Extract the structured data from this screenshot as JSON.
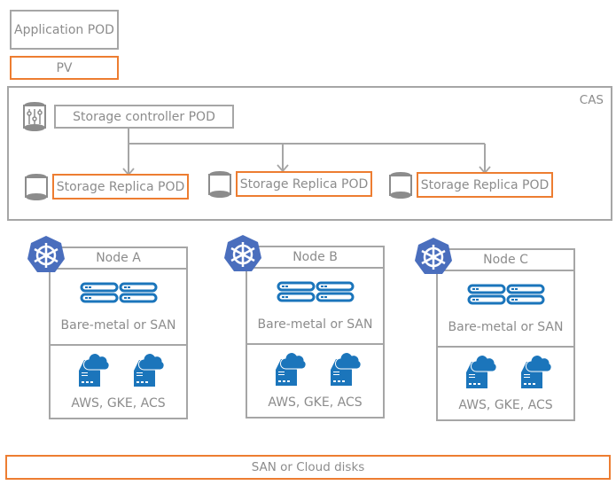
{
  "legend": {
    "application_pod": "Application POD",
    "pv": "PV"
  },
  "cas": {
    "label": "CAS",
    "controller": {
      "label": "Storage controller POD",
      "icon": "storage-controller-cylinder-icon"
    },
    "replicas": [
      {
        "label": "Storage Replica POD",
        "icon": "storage-cylinder-icon"
      },
      {
        "label": "Storage Replica POD",
        "icon": "storage-cylinder-icon"
      },
      {
        "label": "Storage Replica POD",
        "icon": "storage-cylinder-icon"
      }
    ]
  },
  "nodes": [
    {
      "title": "Node A",
      "bare_metal_label": "Bare-metal or SAN",
      "cloud_label": "AWS, GKE, ACS"
    },
    {
      "title": "Node B",
      "bare_metal_label": "Bare-metal or SAN",
      "cloud_label": "AWS, GKE, ACS"
    },
    {
      "title": "Node C",
      "bare_metal_label": "Bare-metal or SAN",
      "cloud_label": "AWS, GKE, ACS"
    }
  ],
  "footer": {
    "label": "SAN or Cloud disks"
  },
  "colors": {
    "gray_border": "#a6a6a6",
    "orange_border": "#ed7d31",
    "text_gray": "#8c8c8c",
    "kubernetes_blue": "#4a6ebd",
    "server_blue": "#1b75bb"
  }
}
